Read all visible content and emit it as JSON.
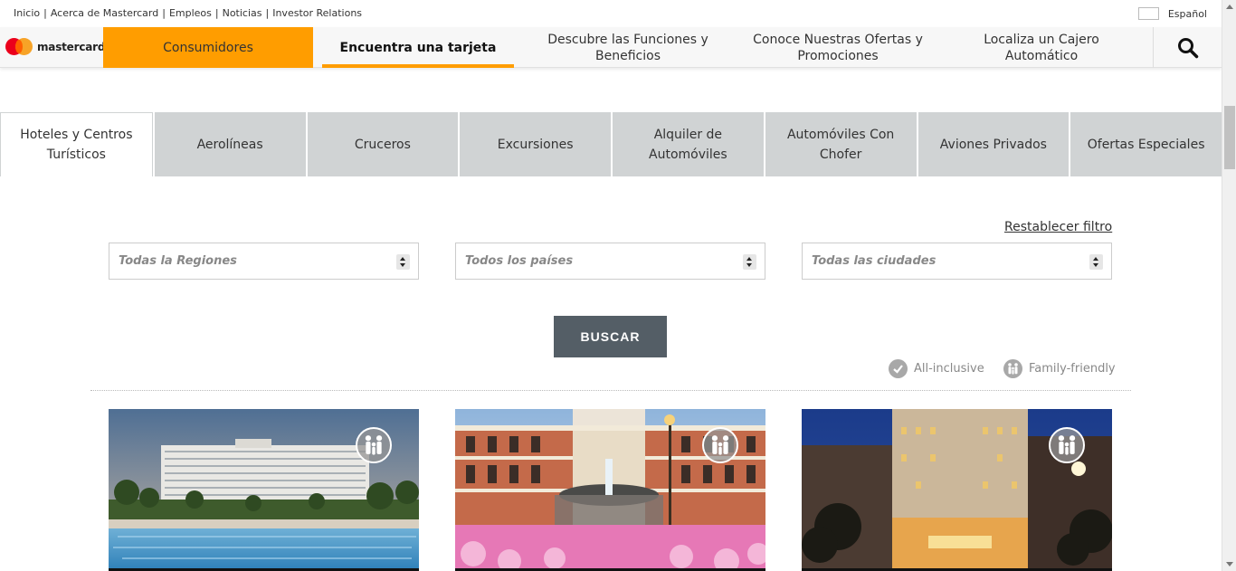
{
  "utility_bar": {
    "links": [
      "Inicio",
      "Acerca de Mastercard",
      "Empleos",
      "Noticias",
      "Investor Relations"
    ],
    "language": "Español"
  },
  "logo": {
    "wordmark": "mastercard"
  },
  "nav": {
    "consumer": "Consumidores",
    "items": [
      {
        "label": "Encuentra una tarjeta",
        "active": true
      },
      {
        "label": "Descubre las Funciones y Beneficios",
        "active": false
      },
      {
        "label": "Conoce Nuestras Ofertas y Promociones",
        "active": false
      },
      {
        "label": "Localiza un Cajero Automático",
        "active": false
      }
    ],
    "search_icon": "search-icon"
  },
  "tabs": [
    {
      "label": "Hoteles y Centros Turísticos",
      "active": true
    },
    {
      "label": "Aerolíneas",
      "active": false
    },
    {
      "label": "Cruceros",
      "active": false
    },
    {
      "label": "Excursiones",
      "active": false
    },
    {
      "label": "Alquiler de Automóviles",
      "active": false
    },
    {
      "label": "Automóviles Con Chofer",
      "active": false
    },
    {
      "label": "Aviones Privados",
      "active": false
    },
    {
      "label": "Ofertas Especiales",
      "active": false
    }
  ],
  "filters": {
    "reset_label": "Restablecer filtro",
    "region": "Todas la Regiones",
    "country": "Todos los países",
    "city": "Todas las ciudades",
    "search_button": "BUSCAR"
  },
  "legend": {
    "all_inclusive": "All-inclusive",
    "family_friendly": "Family-friendly"
  },
  "cards": [
    {
      "icon": "family-icon"
    },
    {
      "icon": "family-icon"
    },
    {
      "icon": "family-icon"
    }
  ],
  "colors": {
    "brand_orange": "#ff9d00",
    "tab_gray": "#d0d3d4",
    "button_gray": "#545e66"
  }
}
